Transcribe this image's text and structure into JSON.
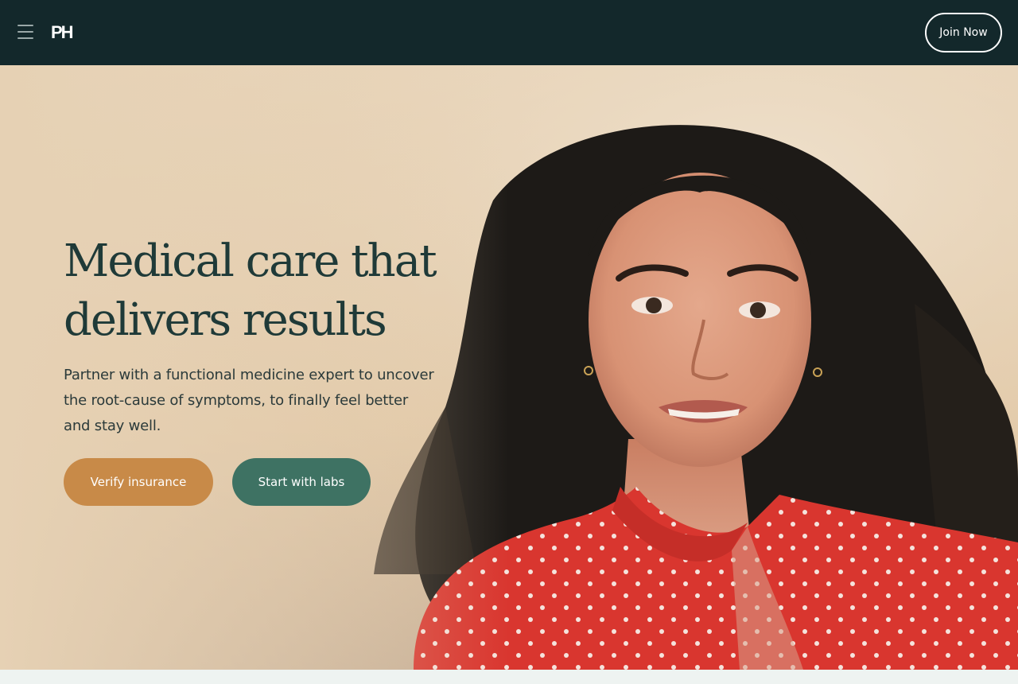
{
  "header": {
    "logo_text": "PH",
    "join_label": "Join Now"
  },
  "hero": {
    "headline": "Medical care that delivers results",
    "subcopy": "Partner with a functional medicine expert to uncover the root-cause of symptoms, to finally feel better and stay well.",
    "verify_label": "Verify insurance",
    "labs_label": "Start with labs"
  },
  "icons": {
    "menu": "hamburger-menu-icon"
  },
  "colors": {
    "topbar": "#13282b",
    "verify_button": "#c88a48",
    "labs_button": "#3e7263",
    "headline": "#1f3a38",
    "shirt": "#d83a33"
  }
}
